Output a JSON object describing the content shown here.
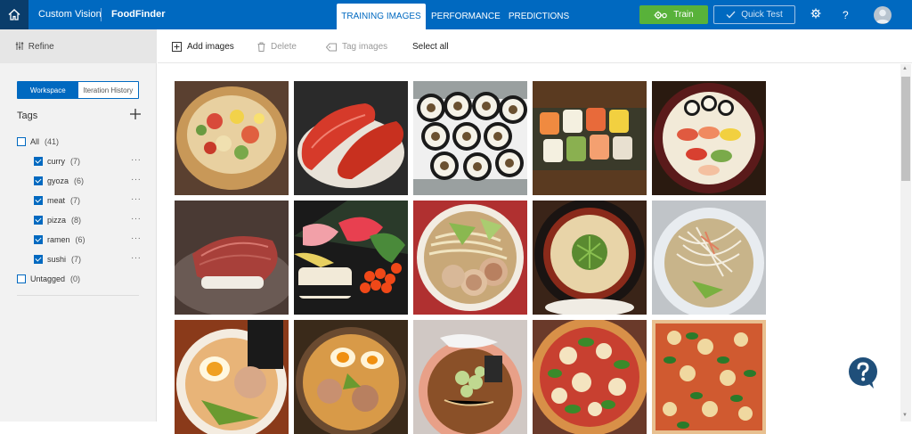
{
  "topbar": {
    "app_name": "Custom Vision",
    "project_name": "FoodFinder",
    "tabs": [
      {
        "label": "TRAINING IMAGES",
        "active": true
      },
      {
        "label": "PERFORMANCE",
        "active": false
      },
      {
        "label": "PREDICTIONS",
        "active": false
      }
    ],
    "train_label": "Train",
    "quick_test_label": "Quick Test",
    "help_label": "?",
    "colors": {
      "bar": "#0069c0",
      "train": "#58b23a"
    }
  },
  "sidebar": {
    "refine_label": "Refine",
    "workspace_label": "Workspace",
    "iteration_label": "Iteration History",
    "tags_title": "Tags",
    "all": {
      "label": "All",
      "count": "(41)"
    },
    "tags": [
      {
        "label": "curry",
        "count": "(7)"
      },
      {
        "label": "gyoza",
        "count": "(6)"
      },
      {
        "label": "meat",
        "count": "(7)"
      },
      {
        "label": "pizza",
        "count": "(8)"
      },
      {
        "label": "ramen",
        "count": "(6)"
      },
      {
        "label": "sushi",
        "count": "(7)"
      }
    ],
    "untagged": {
      "label": "Untagged",
      "count": "(0)"
    },
    "more_icon": "···"
  },
  "toolbar": {
    "add_images": "Add images",
    "delete": "Delete",
    "tag_images": "Tag images",
    "select_all": "Select all"
  },
  "images": [
    {
      "name": "chirashi-bowl"
    },
    {
      "name": "tuna-nigiri"
    },
    {
      "name": "maki-rolls"
    },
    {
      "name": "sushi-tray"
    },
    {
      "name": "sushi-platter"
    },
    {
      "name": "beef-nigiri"
    },
    {
      "name": "sashimi-ikura"
    },
    {
      "name": "ramen-chashu"
    },
    {
      "name": "ramen-tonkotsu"
    },
    {
      "name": "ramen-shio"
    },
    {
      "name": "ramen-egg"
    },
    {
      "name": "ramen-miso"
    },
    {
      "name": "ramen-shoyu"
    },
    {
      "name": "pizza-margherita"
    },
    {
      "name": "pizza-square"
    }
  ]
}
